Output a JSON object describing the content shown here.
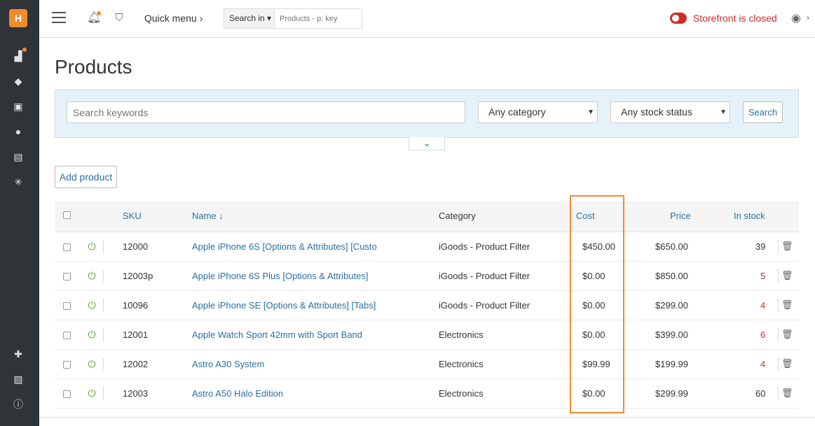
{
  "sidebar": {
    "logo": "H",
    "icons": [
      "dashboard-icon",
      "tags-icon",
      "gift-icon",
      "users-icon",
      "news-icon",
      "network-icon",
      "puzzle-icon",
      "image-icon",
      "info-icon"
    ]
  },
  "topbar": {
    "quick_menu": "Quick menu ›",
    "search_in_label": "Search in ▾",
    "search_placeholder": "Products - p: key",
    "storefront_status": "Storefront is closed"
  },
  "page": {
    "title": "Products"
  },
  "filters": {
    "keywords_placeholder": "Search keywords",
    "category": "Any category",
    "stock_status": "Any stock status",
    "search_label": "Search",
    "expand_glyph": "⌄"
  },
  "actions": {
    "add_product": "Add product"
  },
  "table": {
    "columns": {
      "sku": "SKU",
      "name": "Name ↓",
      "category": "Category",
      "cost": "Cost",
      "price": "Price",
      "in_stock": "In stock"
    },
    "rows": [
      {
        "sku": "12000",
        "name": "Apple iPhone 6S [Options & Attributes] [Custo",
        "category": "iGoods - Product Filter",
        "cost": "$450.00",
        "price": "$650.00",
        "stock": "39",
        "low": false
      },
      {
        "sku": "12003p",
        "name": "Apple iPhone 6S Plus [Options & Attributes]",
        "category": "iGoods - Product Filter",
        "cost": "$0.00",
        "price": "$850.00",
        "stock": "5",
        "low": true
      },
      {
        "sku": "10096",
        "name": "Apple iPhone SE [Options & Attributes] [Tabs]",
        "category": "iGoods - Product Filter",
        "cost": "$0.00",
        "price": "$299.00",
        "stock": "4",
        "low": true
      },
      {
        "sku": "12001",
        "name": "Apple Watch Sport 42mm with Sport Band",
        "category": "Electronics",
        "cost": "$0.00",
        "price": "$399.00",
        "stock": "6",
        "low": true
      },
      {
        "sku": "12002",
        "name": "Astro A30 System",
        "category": "Electronics",
        "cost": "$99.99",
        "price": "$199.99",
        "stock": "4",
        "low": true
      },
      {
        "sku": "12003",
        "name": "Astro A50 Halo Edition",
        "category": "Electronics",
        "cost": "$0.00",
        "price": "$299.99",
        "stock": "60",
        "low": false
      }
    ]
  },
  "colors": {
    "accent": "#2b6ea3",
    "orange": "#f28b2b",
    "danger": "#d42a2a",
    "sidebar": "#2e3438"
  }
}
